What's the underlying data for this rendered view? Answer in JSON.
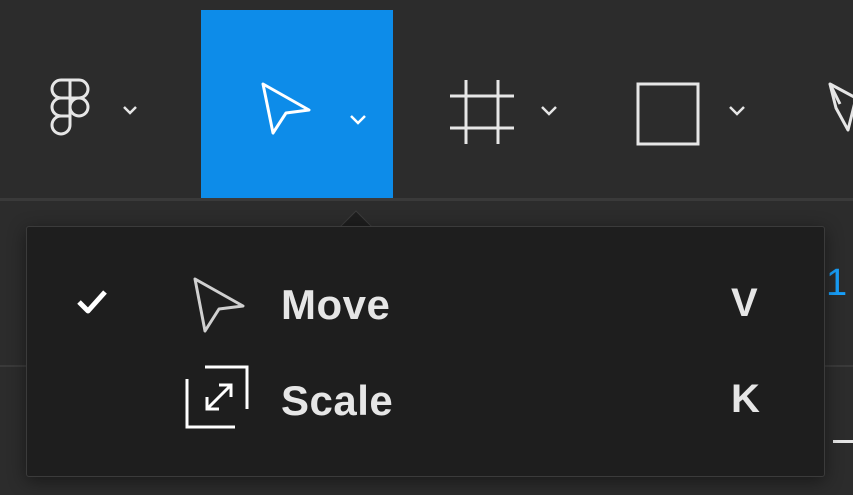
{
  "toolbar": {
    "tools": [
      {
        "name": "figma-menu",
        "icon": "figma-logo-icon",
        "active": false
      },
      {
        "name": "move-tools",
        "icon": "move-cursor-icon",
        "active": true
      },
      {
        "name": "frame-tools",
        "icon": "frame-hash-icon",
        "active": false
      },
      {
        "name": "shape-tools",
        "icon": "rectangle-icon",
        "active": false
      },
      {
        "name": "pen-tools",
        "icon": "pen-icon",
        "active": false
      }
    ],
    "active_color": "#0d8ce9"
  },
  "dropdown": {
    "items": [
      {
        "label": "Move",
        "shortcut": "V",
        "checked": true,
        "icon": "move-cursor-icon"
      },
      {
        "label": "Scale",
        "shortcut": "K",
        "checked": false,
        "icon": "scale-icon"
      }
    ]
  },
  "background": {
    "peek_value": "1"
  }
}
